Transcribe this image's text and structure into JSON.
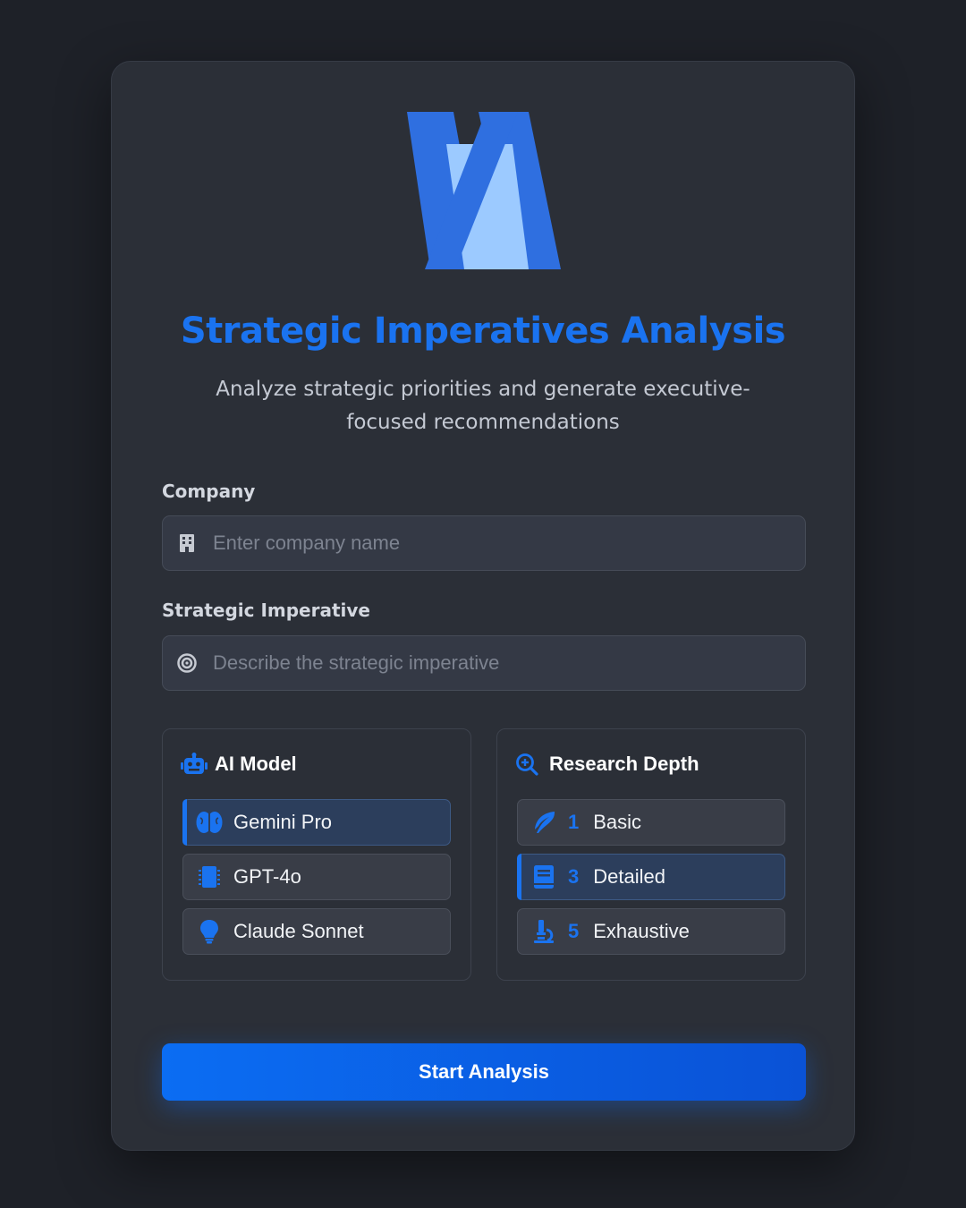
{
  "header": {
    "title": "Strategic Imperatives Analysis",
    "subtitle": "Analyze strategic priorities and generate executive-focused recommendations",
    "logo_icon": "stylized-va-logo"
  },
  "form": {
    "company": {
      "label": "Company",
      "placeholder": "Enter company name",
      "value": "",
      "icon": "building-icon"
    },
    "imperative": {
      "label": "Strategic Imperative",
      "placeholder": "Describe the strategic imperative",
      "value": "",
      "icon": "target-icon"
    }
  },
  "ai_model": {
    "title": "AI Model",
    "icon": "robot-icon",
    "selected": "Gemini Pro",
    "options": [
      {
        "label": "Gemini Pro",
        "icon": "brain-icon"
      },
      {
        "label": "GPT-4o",
        "icon": "chip-icon"
      },
      {
        "label": "Claude Sonnet",
        "icon": "lightbulb-icon"
      }
    ]
  },
  "research_depth": {
    "title": "Research Depth",
    "icon": "search-plus-icon",
    "selected": "Detailed",
    "options": [
      {
        "number": "1",
        "label": "Basic",
        "icon": "feather-icon"
      },
      {
        "number": "3",
        "label": "Detailed",
        "icon": "book-icon"
      },
      {
        "number": "5",
        "label": "Exhaustive",
        "icon": "microscope-icon"
      }
    ]
  },
  "actions": {
    "submit_label": "Start Analysis"
  },
  "colors": {
    "accent": "#1a73f0",
    "background": "#1e2128",
    "card": "#2b2f37",
    "selected_option": "#2c3e5c"
  }
}
